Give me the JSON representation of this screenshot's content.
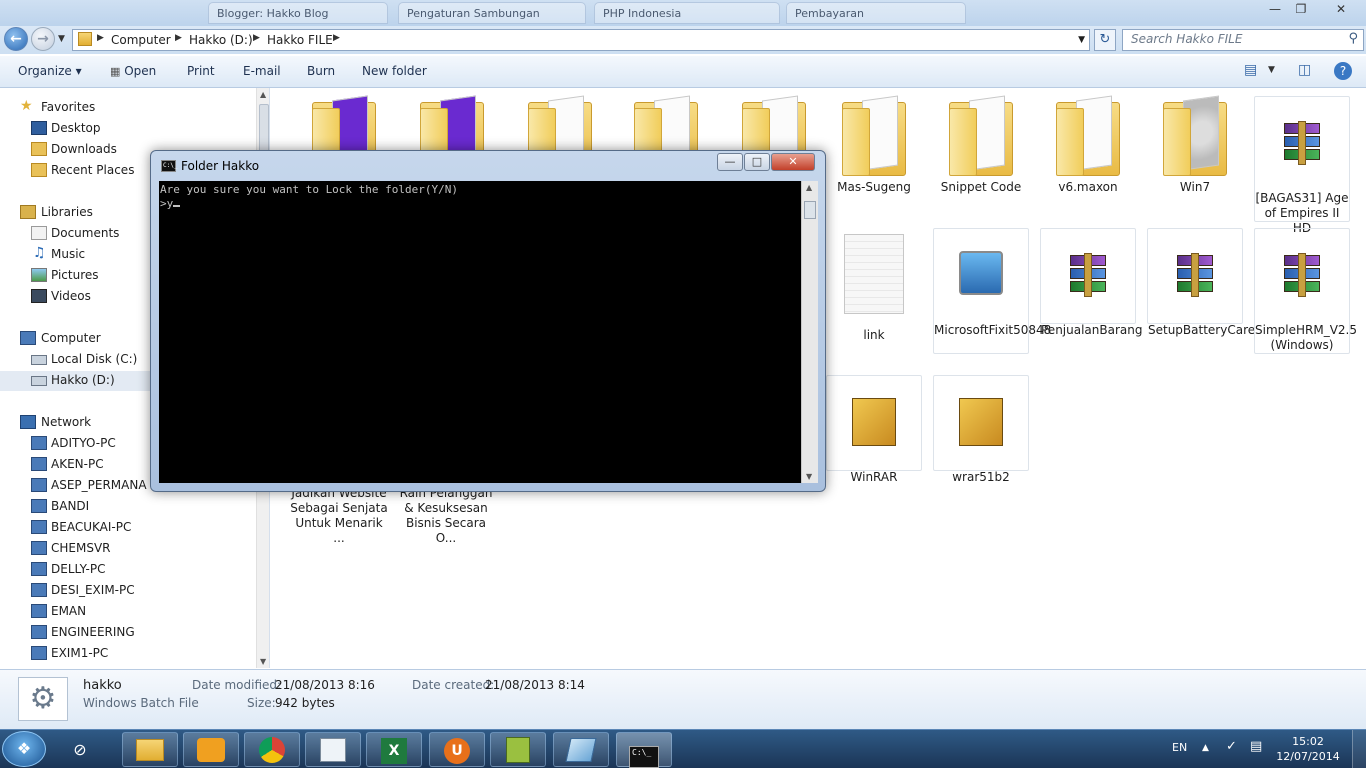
{
  "browser_tabs": [
    "Blogger: Hakko Blog",
    "Pengaturan Sambungan",
    "PHP Indonesia",
    "Pembayaran"
  ],
  "address": {
    "breadcrumbs": [
      "Computer",
      "Hakko (D:)",
      "Hakko FILE"
    ],
    "search_placeholder": "Search Hakko FILE"
  },
  "toolbar": {
    "organize": "Organize",
    "open": "Open",
    "print": "Print",
    "email": "E-mail",
    "burn": "Burn",
    "new_folder": "New folder"
  },
  "nav": {
    "favorites": "Favorites",
    "favorites_items": [
      "Desktop",
      "Downloads",
      "Recent Places"
    ],
    "libraries": "Libraries",
    "libraries_items": [
      "Documents",
      "Music",
      "Pictures",
      "Videos"
    ],
    "computer": "Computer",
    "computer_items": [
      "Local Disk (C:)",
      "Hakko (D:)"
    ],
    "network": "Network",
    "network_items": [
      "ADITYO-PC",
      "AKEN-PC",
      "ASEP_PERMANA",
      "BANDI",
      "BEACUKAI-PC",
      "CHEMSVR",
      "DELLY-PC",
      "DESI_EXIM-PC",
      "EMAN",
      "ENGINEERING",
      "EXIM1-PC"
    ]
  },
  "files": {
    "row1": [
      "Mas-Sugeng",
      "Snippet Code",
      "v6.maxon",
      "Win7",
      "[BAGAS31] Age of Empires II HD"
    ],
    "row2": [
      "link",
      "MicrosoftFixit50848",
      "PenjualanBarang",
      "SetupBatteryCare",
      "SimpleHRM_V2.5 (Windows)"
    ],
    "row3": [
      "WinRAR",
      "wrar51b2"
    ],
    "partial": [
      "Jadikan Website Sebagai Senjata Untuk Menarik ...",
      "Raih Pelanggan & Kesuksesan Bisnis Secara O..."
    ]
  },
  "cmd": {
    "title": "Folder Hakko",
    "icon_text": "C:\\_",
    "line1": "Are you sure you want to Lock the folder(Y/N)",
    "line2": ">y"
  },
  "details": {
    "name": "hakko",
    "type": "Windows Batch File",
    "modified_label": "Date modified:",
    "modified_value": "21/08/2013 8:16",
    "created_label": "Date created:",
    "created_value": "21/08/2013 8:14",
    "size_label": "Size:",
    "size_value": "942 bytes"
  },
  "taskbar": {
    "lang": "EN",
    "time": "15:02",
    "date": "12/07/2014"
  }
}
